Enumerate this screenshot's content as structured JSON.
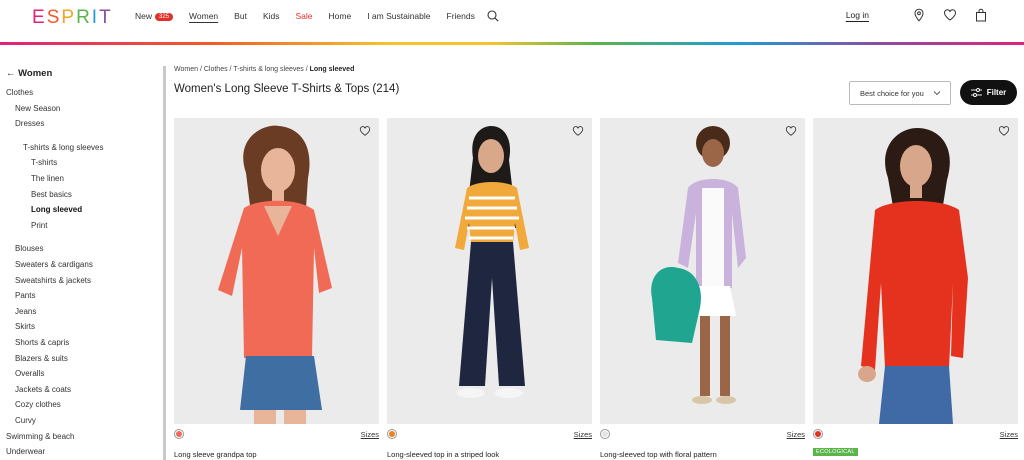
{
  "header": {
    "logo_letters": [
      "E",
      "S",
      "P",
      "R",
      "I",
      "T"
    ],
    "nav": [
      {
        "label": "New",
        "badge": "325"
      },
      {
        "label": "Women",
        "active": true
      },
      {
        "label": "But"
      },
      {
        "label": "Kids"
      },
      {
        "label": "Sale",
        "sale": true
      },
      {
        "label": "Home"
      },
      {
        "label": "I am Sustainable"
      },
      {
        "label": "Friends"
      }
    ],
    "login": "Log in",
    "icons": [
      "search-icon",
      "location-pin-icon",
      "heart-icon",
      "bag-icon"
    ]
  },
  "sidebar": {
    "back": "Women",
    "items": [
      {
        "label": "Clothes",
        "indent": 0
      },
      {
        "label": "New Season",
        "indent": 1
      },
      {
        "label": "Dresses",
        "indent": 1
      },
      {
        "label": "T-shirts & long sleeves",
        "indent": 2
      },
      {
        "label": "T-shirts",
        "indent": 3
      },
      {
        "label": "The linen",
        "indent": 3
      },
      {
        "label": "Best basics",
        "indent": 3
      },
      {
        "label": "Long sleeved",
        "indent": 3,
        "bold": true
      },
      {
        "label": "Print",
        "indent": 3
      },
      {
        "label": "Blouses",
        "indent": 1
      },
      {
        "label": "Sweaters & cardigans",
        "indent": 1
      },
      {
        "label": "Sweatshirts & jackets",
        "indent": 1
      },
      {
        "label": "Pants",
        "indent": 1
      },
      {
        "label": "Jeans",
        "indent": 1
      },
      {
        "label": "Skirts",
        "indent": 1
      },
      {
        "label": "Shorts & capris",
        "indent": 1
      },
      {
        "label": "Blazers & suits",
        "indent": 1
      },
      {
        "label": "Overalls",
        "indent": 1
      },
      {
        "label": "Jackets & coats",
        "indent": 1
      },
      {
        "label": "Cozy clothes",
        "indent": 1
      },
      {
        "label": "Curvy",
        "indent": 1
      },
      {
        "label": "Swimming & beach",
        "indent": 0
      },
      {
        "label": "Underwear",
        "indent": 0
      }
    ]
  },
  "breadcrumb": {
    "items": [
      "Women",
      "Clothes",
      "T-shirts & long sleeves"
    ],
    "separator": "/",
    "current": "Long sleeved"
  },
  "page": {
    "title": "Women's Long Sleeve T-Shirts & Tops (214)",
    "sort_value": "Best choice for you",
    "filter_label": "Filter"
  },
  "products": [
    {
      "name": "Long sleeve grandpa top",
      "sizes": "Sizes",
      "color": "#f06a55",
      "badge": ""
    },
    {
      "name": "Long-sleeved top in a striped look",
      "sizes": "Sizes",
      "color": "#e8831e",
      "badge": ""
    },
    {
      "name": "Long-sleeved top with floral pattern",
      "sizes": "Sizes",
      "color": "#e4e4e4",
      "badge": ""
    },
    {
      "name": "",
      "sizes": "Sizes",
      "color": "#e5321f",
      "badge": "ECOLOGICAL"
    }
  ],
  "colors": {
    "accent": "#e0322b",
    "eco_green": "#5bb54a",
    "photo_bg": "#e9e9e9"
  }
}
